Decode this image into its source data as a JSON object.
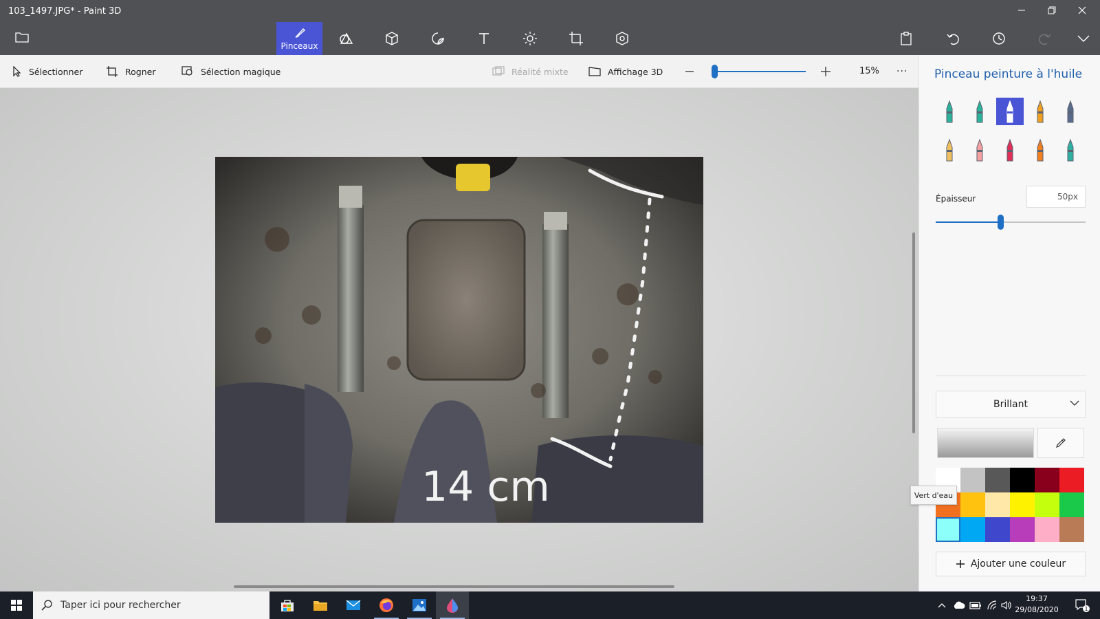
{
  "window": {
    "title": "103_1497.JPG* - Paint 3D",
    "minimize_icon": "minimize-icon",
    "restore_icon": "restore-icon",
    "close_icon": "close-icon"
  },
  "toolbar": {
    "active_tool_label": "Pinceaux",
    "tools": [
      "brushes",
      "2d-shapes",
      "3d-shapes",
      "stickers",
      "text",
      "effects",
      "canvas",
      "3d-library"
    ],
    "right_actions": [
      "paste",
      "undo",
      "history",
      "redo",
      "expand"
    ]
  },
  "subbar": {
    "select_label": "Sélectionner",
    "crop_label": "Rogner",
    "magic_select_label": "Sélection magique",
    "mixed_reality_label": "Réalité mixte",
    "view3d_label": "Affichage 3D",
    "zoom_value": "15%",
    "more_label": "···"
  },
  "canvas": {
    "annotation_text": "14 cm"
  },
  "panel": {
    "title": "Pinceau peinture à l'huile",
    "brushes": [
      {
        "name": "marker",
        "color": "#2bb39a"
      },
      {
        "name": "calligraphy-pen",
        "color": "#2bb39a"
      },
      {
        "name": "oil-brush",
        "color": "#ffffff",
        "active": true
      },
      {
        "name": "watercolor",
        "color": "#f0a020"
      },
      {
        "name": "pixel-pen",
        "color": "#5a6a8a"
      },
      {
        "name": "pencil",
        "color": "#f0c060"
      },
      {
        "name": "eraser",
        "color": "#f4a0a0"
      },
      {
        "name": "crayon",
        "color": "#e0305a"
      },
      {
        "name": "spray-can",
        "color": "#f08020"
      },
      {
        "name": "fill",
        "color": "#30b0a0"
      }
    ],
    "thickness_label": "Épaisseur",
    "thickness_value": "50px",
    "thickness_fraction": 0.43,
    "finish_label": "Brillant",
    "tooltip": "Vert d'eau",
    "add_color_label": "Ajouter une couleur",
    "swatches": [
      "#ffffff",
      "#c3c3c3",
      "#585858",
      "#000000",
      "#88001b",
      "#ec1c24",
      "#f07020",
      "#ffc20e",
      "#ffe8a8",
      "#fff200",
      "#c4ff0e",
      "#1ac84a",
      "#8cfffb",
      "#00a8f3",
      "#3f48cc",
      "#b83dba",
      "#ffaec8",
      "#b97a56"
    ],
    "selected_swatch": 12
  },
  "taskbar": {
    "search_placeholder": "Taper ici pour rechercher",
    "apps": [
      "store",
      "file-explorer",
      "mail",
      "firefox",
      "photos",
      "paint-3d"
    ],
    "time": "19:37",
    "date": "29/08/2020",
    "notification_count": "1"
  }
}
